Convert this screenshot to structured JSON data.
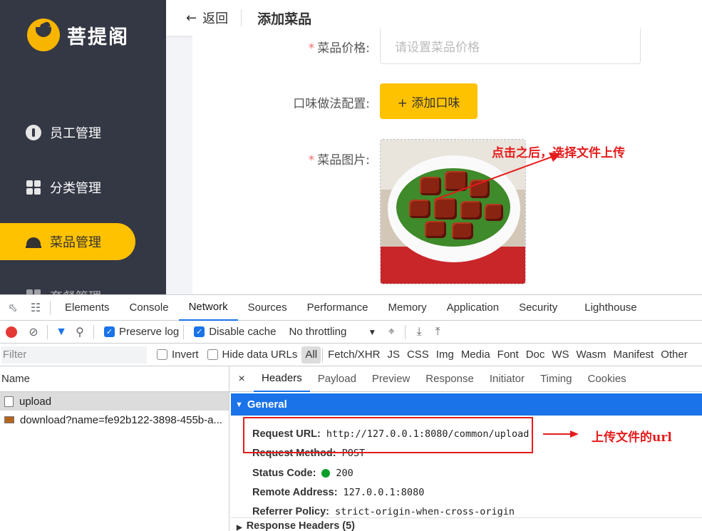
{
  "app": {
    "logo_text": "菩提阁",
    "nav": [
      {
        "label": "员工管理",
        "icon": "employee-icon"
      },
      {
        "label": "分类管理",
        "icon": "category-grid-icon"
      },
      {
        "label": "菜品管理",
        "icon": "dish-cloche-icon"
      },
      {
        "label": "套餐管理",
        "icon": "combo-icon"
      }
    ],
    "topbar": {
      "back_label": "返回",
      "title": "添加菜品"
    },
    "form": {
      "price_label": "菜品价格:",
      "price_placeholder": "请设置菜品价格",
      "flavor_label": "口味做法配置:",
      "flavor_button": "+ 添加口味",
      "image_label": "菜品图片:",
      "required_mark": "*"
    },
    "accent_color": "#ffc200",
    "sidebar_color": "#343744"
  },
  "annotations": {
    "upload_hint": "点击之后，选择文件上传",
    "url_hint": "上传文件的url",
    "color": "#e51c1c"
  },
  "devtools": {
    "tabs": [
      "Elements",
      "Console",
      "Network",
      "Sources",
      "Performance",
      "Memory",
      "Application",
      "Security",
      "Lighthouse"
    ],
    "active_tab": "Network",
    "toolbar": {
      "preserve_log": "Preserve log",
      "disable_cache": "Disable cache",
      "throttling": "No throttling"
    },
    "filter": {
      "placeholder": "Filter",
      "invert": "Invert",
      "hide_data_urls": "Hide data URLs",
      "types": [
        "All",
        "Fetch/XHR",
        "JS",
        "CSS",
        "Img",
        "Media",
        "Font",
        "Doc",
        "WS",
        "Wasm",
        "Manifest",
        "Other"
      ]
    },
    "list": {
      "header": "Name",
      "rows": [
        "upload",
        "download?name=fe92b122-3898-455b-a..."
      ]
    },
    "detail": {
      "close": "×",
      "tabs": [
        "Headers",
        "Payload",
        "Preview",
        "Response",
        "Initiator",
        "Timing",
        "Cookies"
      ],
      "general_label": "General",
      "fields": [
        {
          "key": "Request URL:",
          "value": "http://127.0.0.1:8080/common/upload"
        },
        {
          "key": "Request Method:",
          "value": "POST"
        },
        {
          "key": "Status Code:",
          "value": "200"
        },
        {
          "key": "Remote Address:",
          "value": "127.0.0.1:8080"
        },
        {
          "key": "Referrer Policy:",
          "value": "strict-origin-when-cross-origin"
        }
      ],
      "response_headers": "Response Headers (5)"
    }
  }
}
